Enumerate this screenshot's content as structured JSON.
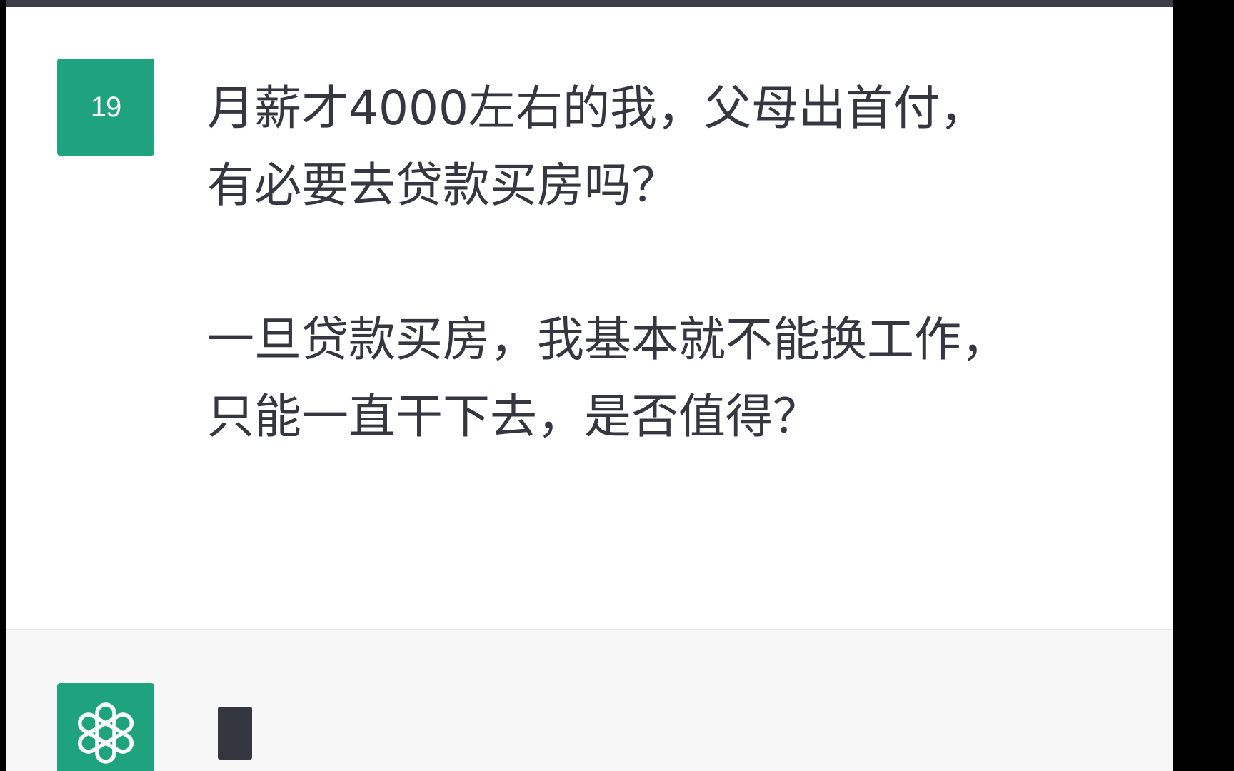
{
  "user_message": {
    "avatar_text": "19",
    "lines": [
      "月薪才4000左右的我，父母出首付，",
      "有必要去贷款买房吗？",
      "一旦贷款买房，我基本就不能换工作，",
      "只能一直干下去，是否值得？"
    ]
  },
  "assistant_message": {
    "avatar_icon": "openai-logo-icon",
    "status": "typing-cursor"
  },
  "colors": {
    "avatar_green": "#1fa37f",
    "text": "#353740",
    "assistant_bg": "#f7f7f8",
    "top_bar": "#3b3d48"
  }
}
